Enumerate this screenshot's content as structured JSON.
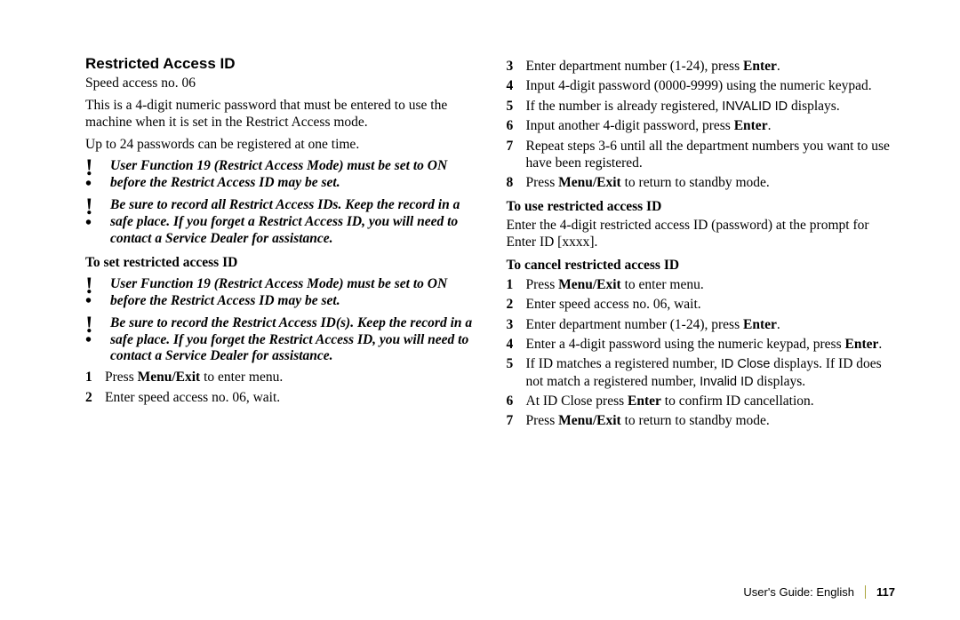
{
  "left": {
    "title": "Restricted Access ID",
    "speedAccess": "Speed access no. 06",
    "intro": "This is a 4-digit numeric password that must be entered to use the machine when it is set in the Restrict Access mode.",
    "limit": "Up to 24 passwords can be registered at one time.",
    "note1": "User Function 19 (Restrict Access Mode) must be set to ON before the Restrict Access ID may be set.",
    "note2": "Be sure to record all Restrict Access IDs.  Keep the record in a safe place.  If you forget a Restrict Access ID, you will need to contact a Service Dealer for assistance.",
    "subhead": "To set restricted access ID",
    "note3": "User Function 19 (Restrict Access Mode) must be set to ON before the Restrict Access ID may be set.",
    "note4": "Be sure to record the Restrict Access ID(s).  Keep the record in a safe place.  If you forget the Restrict Access ID, you will need to contact a Service Dealer for assistance.",
    "step1a": "Press ",
    "step1b": "Menu/Exit",
    "step1c": " to enter menu.",
    "step2": "Enter speed access no. 06, wait."
  },
  "right": {
    "r3a": "Enter department number (1-24), press ",
    "r3b": "Enter",
    "r3c": ".",
    "r4": "Input 4-digit password (0000-9999) using the numeric keypad.",
    "r5a": "If the number is already registered, ",
    "r5b": "INVALID ID",
    "r5c": "  displays.",
    "r6a": "Input another 4-digit password, press ",
    "r6b": "Enter",
    "r6c": ".",
    "r7": "Repeat steps 3-6 until all the department numbers you want to use have been registered.",
    "r8a": "Press ",
    "r8b": "Menu/Exit",
    "r8c": " to return to standby mode.",
    "subheadUse": "To use restricted access ID",
    "usePara": "Enter the 4-digit restricted access ID (password) at the prompt for Enter ID [xxxx].",
    "subheadCancel": "To cancel restricted access ID",
    "c1a": "Press ",
    "c1b": "Menu/Exit",
    "c1c": " to enter menu.",
    "c2": "Enter speed access no. 06, wait.",
    "c3a": "Enter department number (1-24), press ",
    "c3b": "Enter",
    "c3c": ".",
    "c4a": "Enter a 4-digit password using the numeric keypad, press ",
    "c4b": "Enter",
    "c4c": ".",
    "c5a": "If ID matches a registered number, ",
    "c5b": "ID Close",
    "c5c": " displays.  If ID does not match a registered number, ",
    "c5d": "Invalid ID",
    "c5e": " displays.",
    "c6a": "At ID Close press ",
    "c6b": "Enter",
    "c6c": " to confirm ID cancellation.",
    "c7a": "Press ",
    "c7b": "Menu/Exit",
    "c7c": " to return to standby mode."
  },
  "footer": {
    "guide": "User's Guide:  English",
    "page": "117"
  }
}
